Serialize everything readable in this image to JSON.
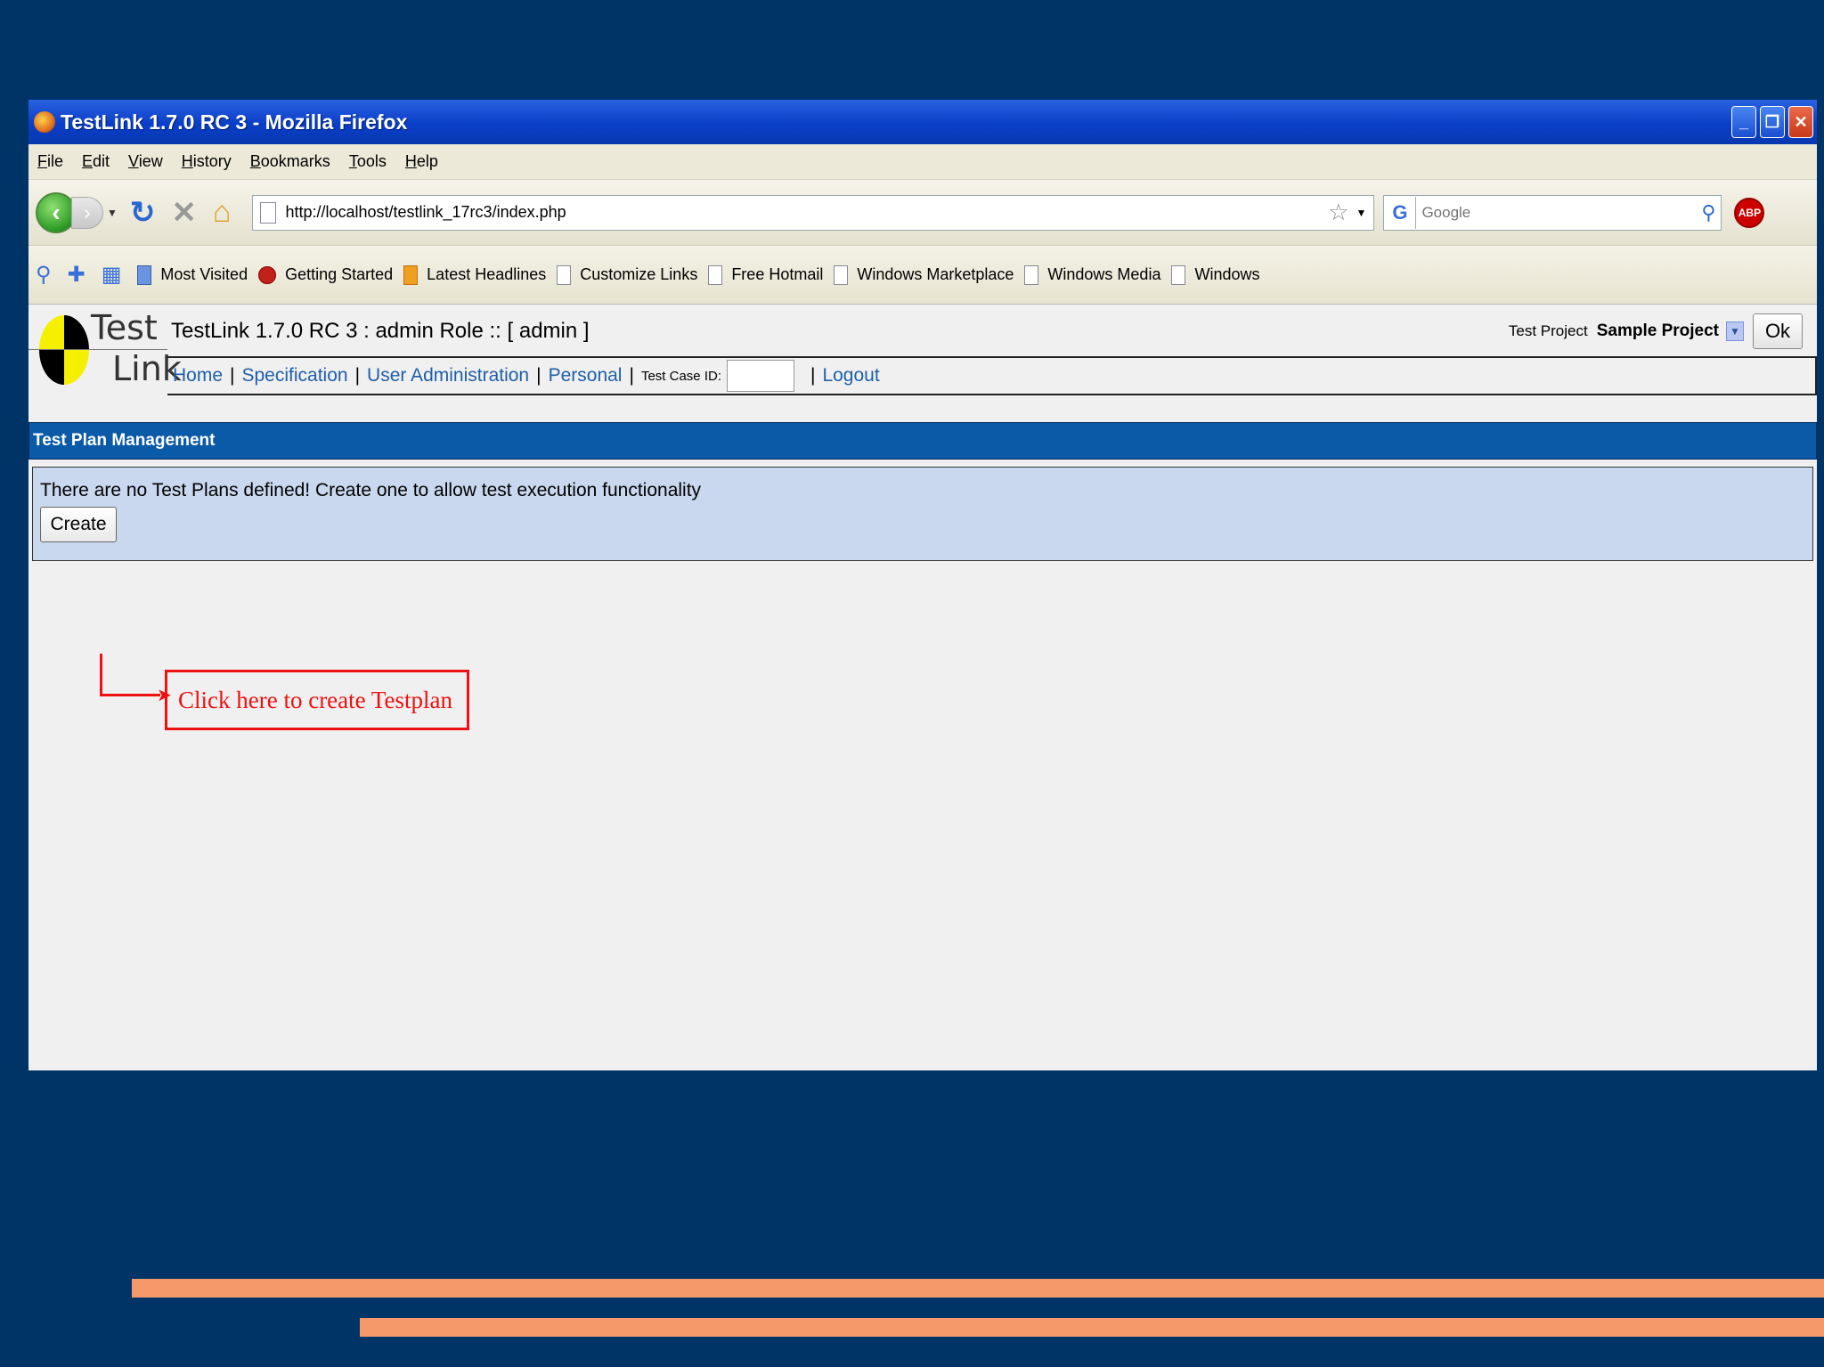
{
  "window": {
    "title": "TestLink 1.7.0 RC 3 - Mozilla Firefox",
    "controls": [
      "minimize",
      "restore",
      "close"
    ]
  },
  "menu": [
    "File",
    "Edit",
    "View",
    "History",
    "Bookmarks",
    "Tools",
    "Help"
  ],
  "navbar": {
    "url": "http://localhost/testlink_17rc3/index.php",
    "search_placeholder": "Google"
  },
  "bookmarks": [
    "Most Visited",
    "Getting Started",
    "Latest Headlines",
    "Customize Links",
    "Free Hotmail",
    "Windows Marketplace",
    "Windows Media",
    "Windows"
  ],
  "testlink": {
    "logo_line1": "Test",
    "logo_line2": "Link",
    "title": "TestLink 1.7.0 RC 3 : admin Role :: [ admin ]",
    "project_label": "Test Project",
    "project_name": "Sample Project",
    "ok_label": "Ok",
    "nav": {
      "home": "Home",
      "specification": "Specification",
      "user_admin": "User Administration",
      "personal": "Personal",
      "test_case_id_label": "Test Case ID:",
      "logout": "Logout"
    },
    "section_title": "Test Plan Management",
    "notice": "There are no Test Plans defined! Create one to allow test execution functionality",
    "create_label": "Create"
  },
  "annotation": {
    "text": "Click here to create Testplan",
    "color": "#ee1111"
  },
  "colors": {
    "background": "#003366",
    "section_bar": "#0b5aa8",
    "notice_bg": "#c9d8ee",
    "link": "#1f5fa8",
    "stripe": "#f5996a"
  }
}
